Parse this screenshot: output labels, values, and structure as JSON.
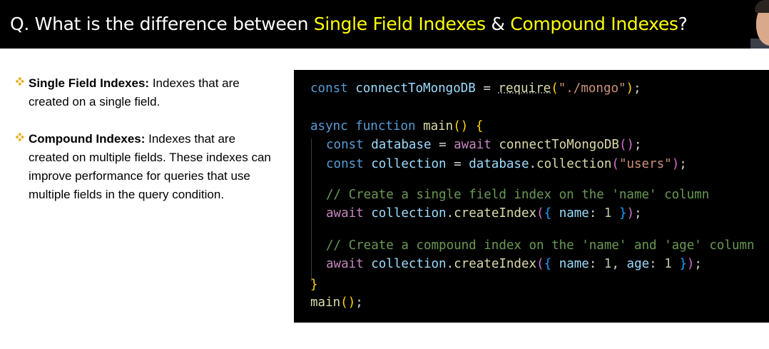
{
  "header": {
    "title_prefix": "Q. What is the difference between ",
    "highlight1": "Single Field Indexes",
    "connector": " & ",
    "highlight2": "Compound Indexes",
    "title_suffix": "?"
  },
  "bullets": [
    {
      "term": "Single Field Indexes:",
      "text": " Indexes that are created on a single field."
    },
    {
      "term": "Compound Indexes:",
      "text": " Indexes that are created on multiple fields. These indexes can improve performance for queries that use multiple fields in the query condition."
    }
  ],
  "code": {
    "l1": {
      "k": "const",
      "n": "connectToMongoDB",
      "eq": " = ",
      "f": "require",
      "o": "(",
      "s": "\"./mongo\"",
      "c": ");"
    },
    "l2": {
      "a": "async",
      "f": "function",
      "n": "main",
      "p": "()",
      "b": "{"
    },
    "l3": {
      "k": "const",
      "n": "database",
      "eq": " = ",
      "aw": "await",
      "f": "connectToMongoDB",
      "p": "()",
      "e": ";"
    },
    "l4": {
      "k": "const",
      "n": "collection",
      "eq": " = ",
      "v": "database",
      "d": ".",
      "f": "collection",
      "o": "(",
      "s": "\"users\"",
      "c": ")",
      "e": ";"
    },
    "l5": {
      "cm": "// Create a single field index on the 'name' column"
    },
    "l6": {
      "aw": "await",
      "v": "collection",
      "d": ".",
      "f": "createIndex",
      "o": "(",
      "ob": "{",
      "key": "name",
      "col": ": ",
      "num": "1",
      "cb": "}",
      "c": ")",
      "e": ";"
    },
    "l7": {
      "cm": "// Create a compound index on the 'name' and 'age' column"
    },
    "l8": {
      "aw": "await",
      "v": "collection",
      "d": ".",
      "f": "createIndex",
      "o": "(",
      "ob": "{",
      "k1": "name",
      "c1": ": ",
      "n1": "1",
      "sep": ", ",
      "k2": "age",
      "c2": ": ",
      "n2": "1",
      "cb": "}",
      "c": ")",
      "e": ";"
    },
    "l9": {
      "b": "}"
    },
    "l10": {
      "f": "main",
      "p": "()",
      "e": ";"
    }
  },
  "colors": {
    "header_bg": "#000000",
    "highlight": "#ffff00",
    "bullet_diamond": "#e8b020",
    "code_bg": "#000000"
  },
  "icons": {
    "bullet": "four-diamond-bullet-icon"
  }
}
